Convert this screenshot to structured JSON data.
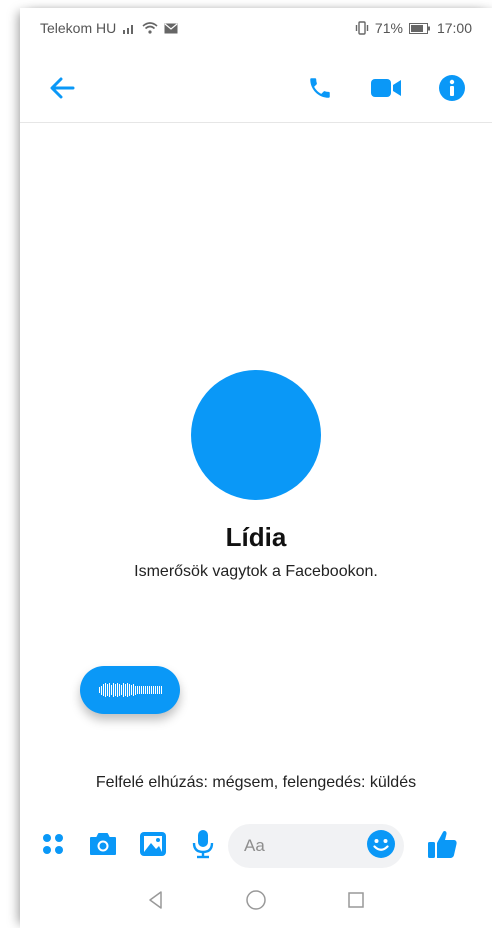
{
  "status_bar": {
    "carrier": "Telekom HU",
    "battery_percent": "71%",
    "time": "17:00"
  },
  "contact": {
    "name": "Lídia",
    "subtitle": "Ismerősök vagytok a Facebookon."
  },
  "composer": {
    "hint": "Felfelé elhúzás: mégsem, felengedés: küldés",
    "placeholder": "Aa"
  },
  "icons": {
    "back": "arrow-left-icon",
    "call": "phone-icon",
    "video": "video-camera-icon",
    "info": "info-icon",
    "more": "four-dots-icon",
    "camera": "camera-icon",
    "gallery": "image-icon",
    "mic": "microphone-icon",
    "emoji": "smiley-icon",
    "like": "thumbs-up-icon"
  },
  "colors": {
    "accent": "#0a98f7",
    "avatar": "#0a98f7"
  }
}
